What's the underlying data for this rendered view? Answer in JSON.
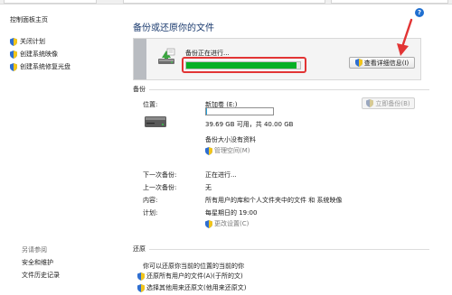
{
  "sidebar": {
    "home_label": "控制面板主页",
    "links": [
      {
        "label": "关闭计划",
        "icon": "shield-icon"
      },
      {
        "label": "创建系统映像",
        "icon": "shield-icon"
      },
      {
        "label": "创建系统修复光盘",
        "icon": "shield-icon"
      }
    ],
    "see_also_label": "另请参阅",
    "see_also_links": [
      "安全和维护",
      "文件历史记录"
    ]
  },
  "help_label": "?",
  "main": {
    "title": "备份或还原你的文件",
    "progress": {
      "title": "备份正在进行...",
      "fraction": 0.97,
      "details_button": "查看详细信息(I)"
    },
    "backup_section": {
      "heading": "备份",
      "location_label": "位置:",
      "drive_name": "新加卷 (E:)",
      "capacity_fraction": 0.01,
      "capacity_text": "39.69 GB 可用，共 40.00 GB",
      "backup_now_button": "立即备份(B)",
      "size_text": "备份大小没有资料",
      "manage_space_link": "管理空间(M)",
      "next_backup_label": "下一次备份:",
      "next_backup_value": "正在进行...",
      "last_backup_label": "上一次备份:",
      "last_backup_value": "无",
      "contents_label": "内容:",
      "contents_value": "所有用户的库和个人文件夹中的文件 和 系统映像",
      "schedule_label": "计划:",
      "schedule_value": "每星期日的 19:00",
      "change_settings_link": "更改设置(C)"
    },
    "restore_section": {
      "heading": "还原",
      "description": "你可以还原你当前的位置的当前的你",
      "restore_all_link": "还原所有用户的文件(A)(于所的文)",
      "select_other_link": "选择其他用来还原文(他用来还原文)"
    }
  },
  "colors": {
    "progress_green": "#06b025",
    "highlight_red": "#e23434",
    "title_blue": "#1a3a6e",
    "capacity_blue": "#26a0da"
  }
}
